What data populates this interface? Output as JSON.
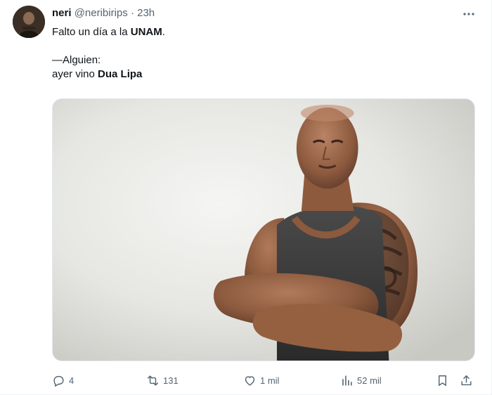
{
  "user": {
    "name": "neri",
    "handle": "@neribirips",
    "separator": "·",
    "time": "23h"
  },
  "tweet": {
    "line1_prefix": "Falto un día a la ",
    "line1_bold": "UNAM",
    "line1_suffix": ".",
    "line2": "—Alguien:",
    "line3_prefix": "ayer vino ",
    "line3_bold": "Dua Lipa"
  },
  "media": {
    "subject": "muscular man with crossed arms and tribal tattoo, grey background",
    "accent_color": "#e8e8e5"
  },
  "actions": {
    "replies": "4",
    "retweets": "131",
    "likes": "1 mil",
    "views": "52 mil"
  },
  "icons": {
    "more": "more-dots-icon",
    "reply": "reply-bubble-icon",
    "retweet": "retweet-arrows-icon",
    "like": "heart-icon",
    "views": "bar-chart-icon",
    "bookmark": "bookmark-icon",
    "share": "share-upload-icon"
  },
  "colors": {
    "text_primary": "#0f1419",
    "text_secondary": "#536471",
    "border": "#eff3f4"
  }
}
